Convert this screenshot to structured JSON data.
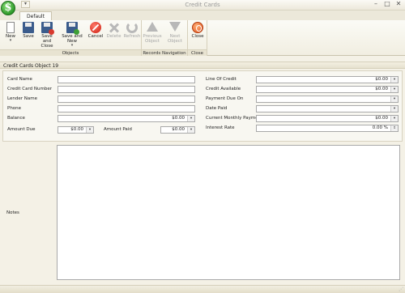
{
  "window": {
    "title": "Credit Cards"
  },
  "tabs": [
    {
      "label": "Default"
    }
  ],
  "ribbon": {
    "groups": [
      {
        "label": "Objects"
      },
      {
        "label": "Records Navigation"
      },
      {
        "label": "Close"
      }
    ],
    "buttons": {
      "new": "New",
      "save": "Save",
      "save_close": "Save and Close",
      "save_new": "Save and New",
      "cancel": "Cancel",
      "delete": "Delete",
      "refresh": "Refresh",
      "previous": "Previous Object",
      "next": "Next Object",
      "close": "Close"
    }
  },
  "form": {
    "header": "Credit Cards Object 19",
    "left": {
      "card_name": {
        "label": "Card Name",
        "value": ""
      },
      "card_number": {
        "label": "Credit Card Number",
        "value": ""
      },
      "lender_name": {
        "label": "Lender Name",
        "value": ""
      },
      "phone": {
        "label": "Phone",
        "value": ""
      },
      "balance": {
        "label": "Balance",
        "value": "$0.00"
      },
      "amount_due": {
        "label": "Amount Due",
        "value": "$0.00"
      },
      "amount_paid": {
        "label": "Amount Paid",
        "value": "$0.00"
      }
    },
    "right": {
      "line_of_credit": {
        "label": "Line Of Credit",
        "value": "$0.00"
      },
      "credit_available": {
        "label": "Credit Available",
        "value": "$0.00"
      },
      "payment_due_on": {
        "label": "Payment Due On",
        "value": ""
      },
      "date_paid": {
        "label": "Date Paid",
        "value": ""
      },
      "current_monthly_payment": {
        "label": "Current Monthly Payment",
        "value": "$0.00"
      },
      "interest_rate": {
        "label": "Interest Rate",
        "value": "0.00 %"
      }
    },
    "notes": {
      "label": "Notes",
      "value": ""
    }
  },
  "icons": {
    "logo": "dollar-icon",
    "new": "new-document-icon",
    "save": "floppy-disk-icon",
    "cancel": "cancel-icon",
    "delete": "delete-icon",
    "refresh": "refresh-icon",
    "previous": "arrow-up-icon",
    "next": "arrow-down-icon",
    "close": "close-icon"
  },
  "logo_text": "$",
  "colors": {
    "window_bg": "#f4f1e6",
    "ribbon_bg": "#f1eee1",
    "accent_green": "#2e9a2a"
  }
}
